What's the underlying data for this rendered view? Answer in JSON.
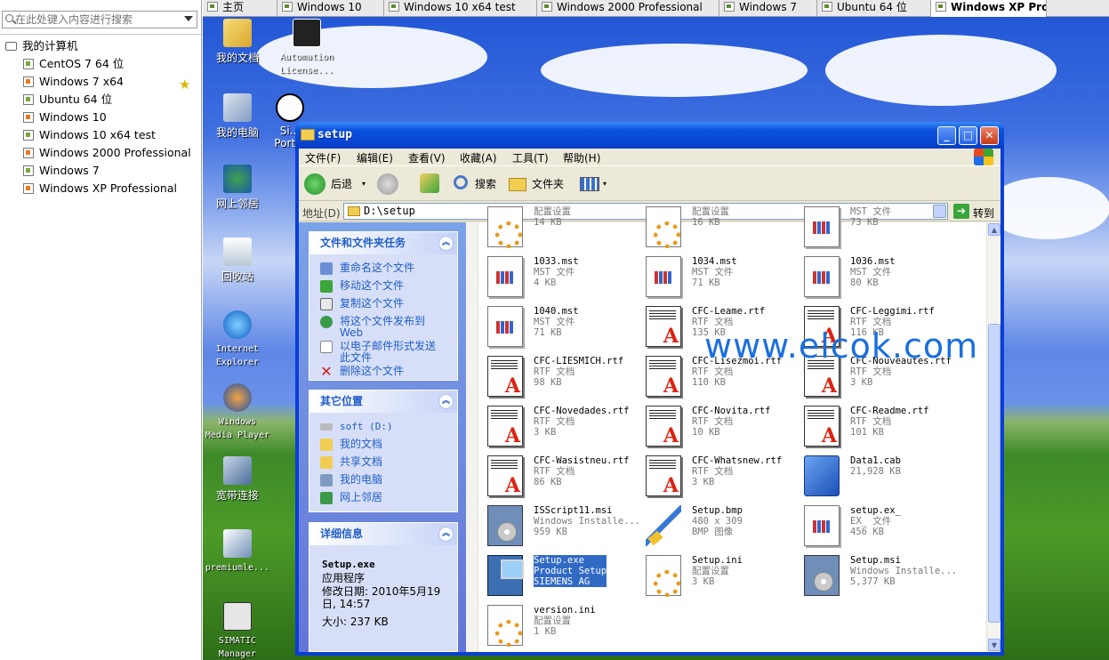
{
  "library": {
    "search_placeholder": "在此处键入内容进行搜索",
    "root_label": "我的计算机",
    "items": [
      {
        "label": "CentOS 7 64 位",
        "favorite": false
      },
      {
        "label": "Windows 7 x64",
        "favorite": true
      },
      {
        "label": "Ubuntu 64 位",
        "favorite": false
      },
      {
        "label": "Windows 10",
        "favorite": false
      },
      {
        "label": "Windows 10 x64 test",
        "favorite": false
      },
      {
        "label": "Windows 2000 Professional",
        "favorite": false
      },
      {
        "label": "Windows 7",
        "favorite": false
      },
      {
        "label": "Windows XP Professional",
        "favorite": false
      }
    ]
  },
  "tabs": [
    {
      "label": "主页"
    },
    {
      "label": "Windows 10"
    },
    {
      "label": "Windows 10 x64 test"
    },
    {
      "label": "Windows 2000 Professional"
    },
    {
      "label": "Windows 7"
    },
    {
      "label": "Ubuntu 64 位"
    },
    {
      "label": "Windows XP Pro..."
    }
  ],
  "desktop_icons": [
    {
      "label": "我的文档"
    },
    {
      "label": "Automation License..."
    },
    {
      "label": "我的电脑"
    },
    {
      "label": "Si... Port..."
    },
    {
      "label": "网上邻居"
    },
    {
      "label": "回收站"
    },
    {
      "label": "Internet Explorer"
    },
    {
      "label": "Windows Media Player"
    },
    {
      "label": "宽带连接"
    },
    {
      "label": "premiumle..."
    },
    {
      "label": "SIMATIC Manager"
    }
  ],
  "window": {
    "title": "setup",
    "menus": [
      "文件(F)",
      "编辑(E)",
      "查看(V)",
      "收藏(A)",
      "工具(T)",
      "帮助(H)"
    ],
    "toolbar": {
      "back": "后退",
      "search": "搜索",
      "folders": "文件夹"
    },
    "address": {
      "label": "地址(D)",
      "value": "D:\\setup",
      "go": "转到"
    },
    "tasks": {
      "title": "文件和文件夹任务",
      "items": [
        "重命名这个文件",
        "移动这个文件",
        "复制这个文件",
        "将这个文件发布到 Web",
        "以电子邮件形式发送此文件",
        "删除这个文件"
      ]
    },
    "places": {
      "title": "其它位置",
      "items": [
        "soft (D:)",
        "我的文档",
        "共享文档",
        "我的电脑",
        "网上邻居"
      ]
    },
    "details": {
      "title": "详细信息",
      "name": "Setup.exe",
      "type": "应用程序",
      "modified": "修改日期: 2010年5月19日, 14:57",
      "size": "大小: 237 KB"
    },
    "watermark": "www.elcok.com",
    "files": [
      {
        "name": "",
        "type": "配置设置",
        "size": "14 KB",
        "icon": "ini"
      },
      {
        "name": "",
        "type": "配置设置",
        "size": "16 KB",
        "icon": "ini"
      },
      {
        "name": "",
        "type": "MST 文件",
        "size": "73 KB",
        "icon": "doc"
      },
      {
        "name": "1033.mst",
        "type": "MST 文件",
        "size": "4 KB",
        "icon": "doc"
      },
      {
        "name": "1034.mst",
        "type": "MST 文件",
        "size": "71 KB",
        "icon": "doc"
      },
      {
        "name": "1036.mst",
        "type": "MST 文件",
        "size": "80 KB",
        "icon": "doc"
      },
      {
        "name": "1040.mst",
        "type": "MST 文件",
        "size": "71 KB",
        "icon": "doc"
      },
      {
        "name": "CFC-Leame.rtf",
        "type": "RTF 文档",
        "size": "135 KB",
        "icon": "rtf"
      },
      {
        "name": "CFC-Leggimi.rtf",
        "type": "RTF 文档",
        "size": "116 KB",
        "icon": "rtf"
      },
      {
        "name": "CFC-LIESMICH.rtf",
        "type": "RTF 文档",
        "size": "98 KB",
        "icon": "rtf"
      },
      {
        "name": "CFC-Lisezmoi.rtf",
        "type": "RTF 文档",
        "size": "110 KB",
        "icon": "rtf"
      },
      {
        "name": "CFC-Nouveautes.rtf",
        "type": "RTF 文档",
        "size": "3 KB",
        "icon": "rtf"
      },
      {
        "name": "CFC-Novedades.rtf",
        "type": "RTF 文档",
        "size": "3 KB",
        "icon": "rtf"
      },
      {
        "name": "CFC-Novita.rtf",
        "type": "RTF 文档",
        "size": "10 KB",
        "icon": "rtf"
      },
      {
        "name": "CFC-Readme.rtf",
        "type": "RTF 文档",
        "size": "101 KB",
        "icon": "rtf"
      },
      {
        "name": "CFC-Wasistneu.rtf",
        "type": "RTF 文档",
        "size": "86 KB",
        "icon": "rtf"
      },
      {
        "name": "CFC-Whatsnew.rtf",
        "type": "RTF 文档",
        "size": "3 KB",
        "icon": "rtf"
      },
      {
        "name": "Data1.cab",
        "type": "",
        "size": "21,928 KB",
        "icon": "cab"
      },
      {
        "name": "ISScript11.msi",
        "type": "Windows Installe...",
        "size": "959 KB",
        "icon": "msi"
      },
      {
        "name": "Setup.bmp",
        "type": "480 x 309",
        "size": "BMP 图像",
        "icon": "bmp"
      },
      {
        "name": "setup.ex_",
        "type": "EX_ 文件",
        "size": "456 KB",
        "icon": "doc"
      },
      {
        "name": "Setup.exe",
        "type": "Product Setup",
        "size": "SIEMENS AG",
        "icon": "exe",
        "selected": true
      },
      {
        "name": "Setup.ini",
        "type": "配置设置",
        "size": "3 KB",
        "icon": "ini"
      },
      {
        "name": "Setup.msi",
        "type": "Windows Installe...",
        "size": "5,377 KB",
        "icon": "msi"
      },
      {
        "name": "version.ini",
        "type": "配置设置",
        "size": "1 KB",
        "icon": "ini"
      }
    ]
  }
}
